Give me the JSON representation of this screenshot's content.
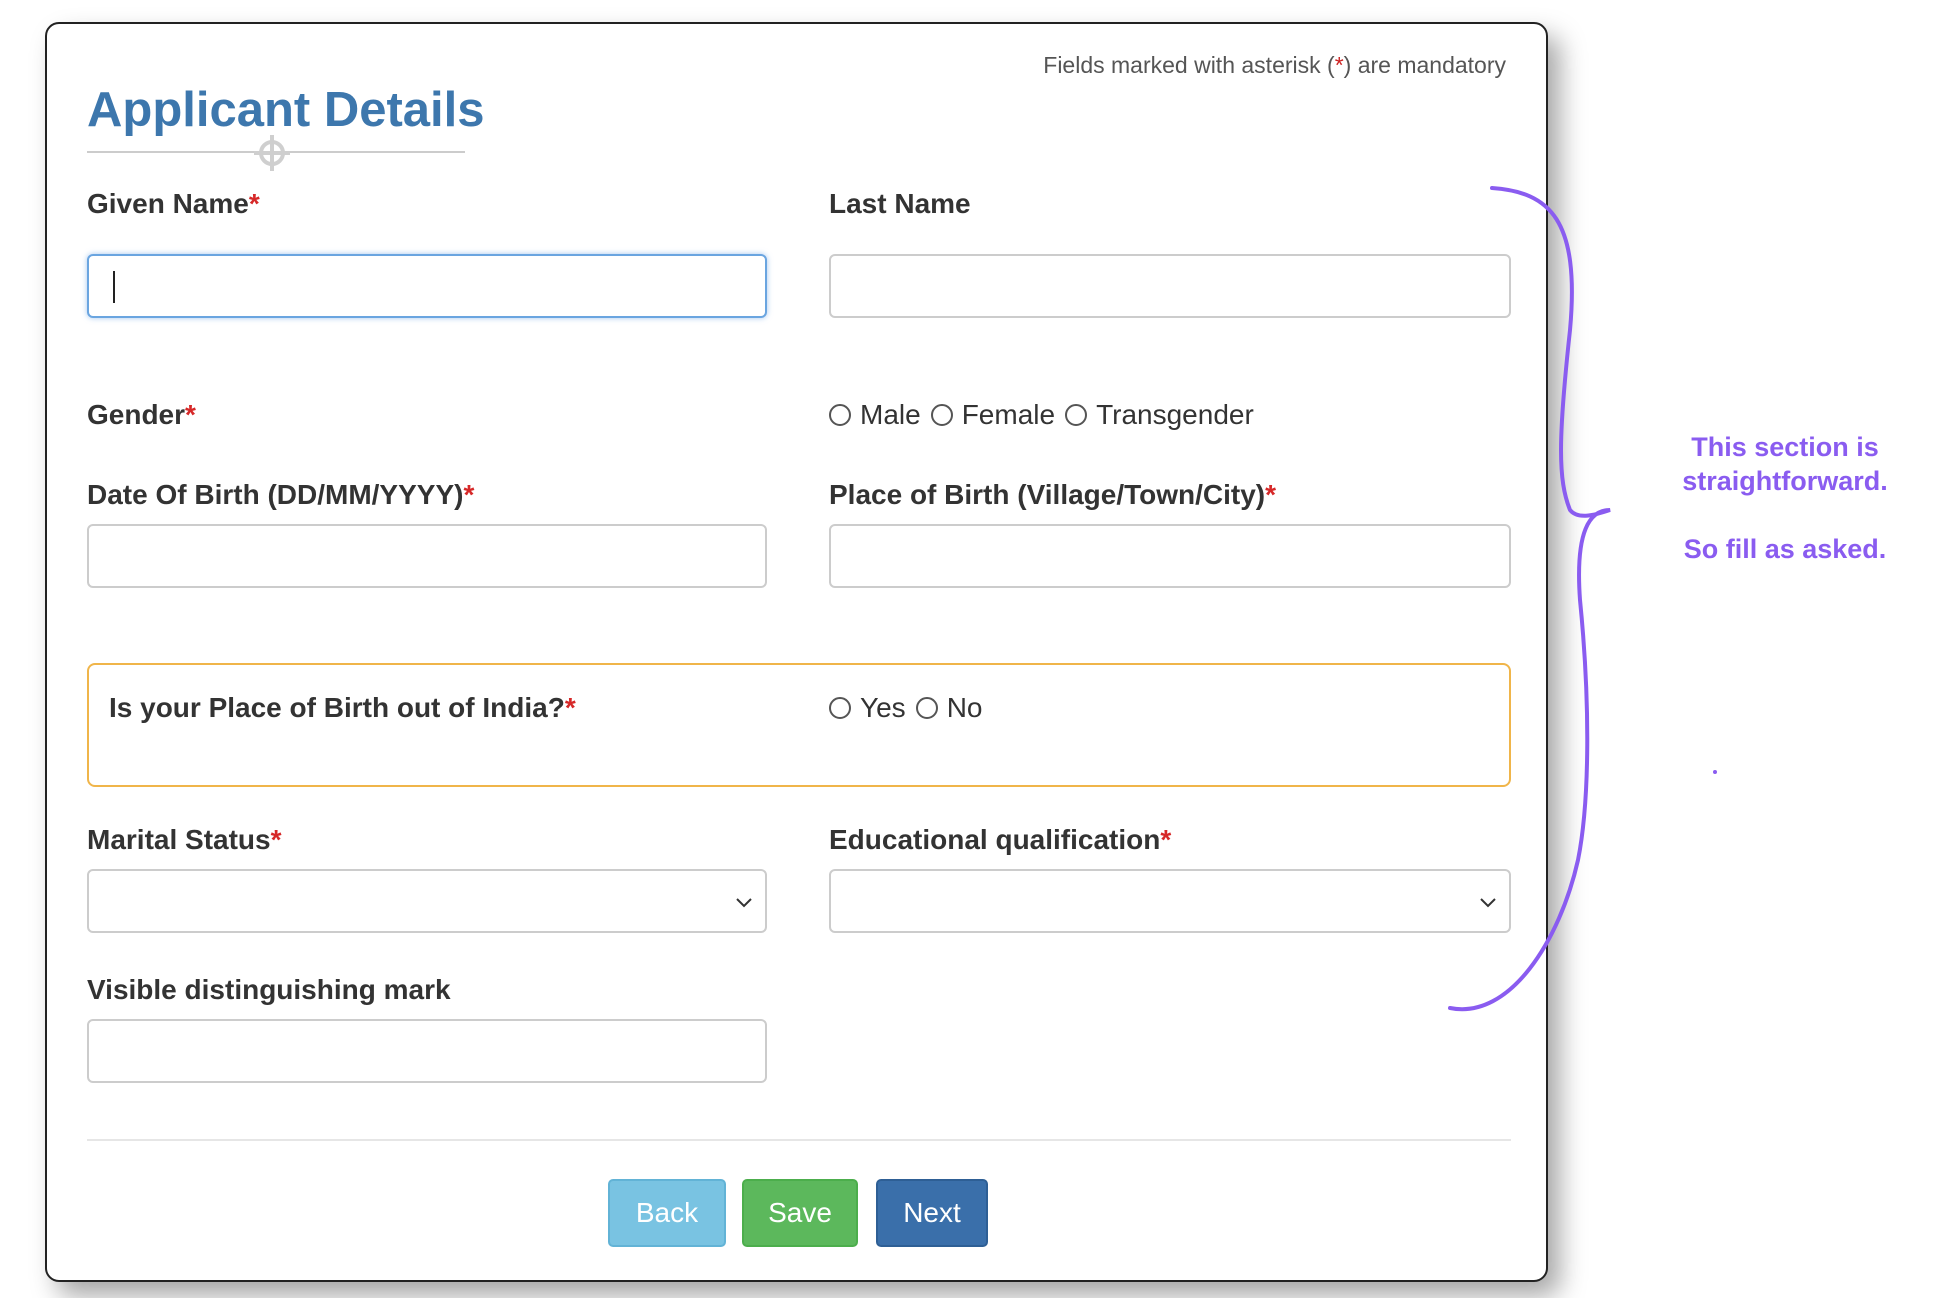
{
  "header": {
    "mandatory_note_prefix": "Fields marked with asterisk (",
    "mandatory_note_star": "*",
    "mandatory_note_suffix": ") are mandatory",
    "title": "Applicant Details"
  },
  "form": {
    "given_name": {
      "label": "Given Name",
      "value": ""
    },
    "last_name": {
      "label": "Last Name",
      "value": ""
    },
    "gender": {
      "label": "Gender",
      "options": [
        "Male",
        "Female",
        "Transgender"
      ]
    },
    "dob": {
      "label": "Date Of Birth (DD/MM/YYYY)",
      "value": ""
    },
    "place_of_birth": {
      "label": "Place of Birth (Village/Town/City)",
      "value": ""
    },
    "birth_out_of_india": {
      "label": "Is your Place of Birth out of India?",
      "options": [
        "Yes",
        "No"
      ]
    },
    "marital_status": {
      "label": "Marital Status",
      "value": ""
    },
    "education": {
      "label": "Educational qualification",
      "value": ""
    },
    "distinguishing_mark": {
      "label": "Visible distinguishing mark",
      "value": ""
    },
    "required_marker": "*"
  },
  "buttons": {
    "back": "Back",
    "save": "Save",
    "next": "Next"
  },
  "annotation": {
    "line1": "This section is",
    "line2": "straightforward.",
    "line3": "So fill as asked."
  },
  "colors": {
    "title": "#3d77ad",
    "required": "#d62828",
    "annotation": "#8a5cf0",
    "highlight_border": "#f0b54a",
    "back_button": "#79c3e2",
    "save_button": "#5cb85c",
    "next_button": "#3a6faa"
  },
  "icons": {
    "title_decoration": "crosshair-icon",
    "select_arrow": "chevron-down-icon"
  }
}
